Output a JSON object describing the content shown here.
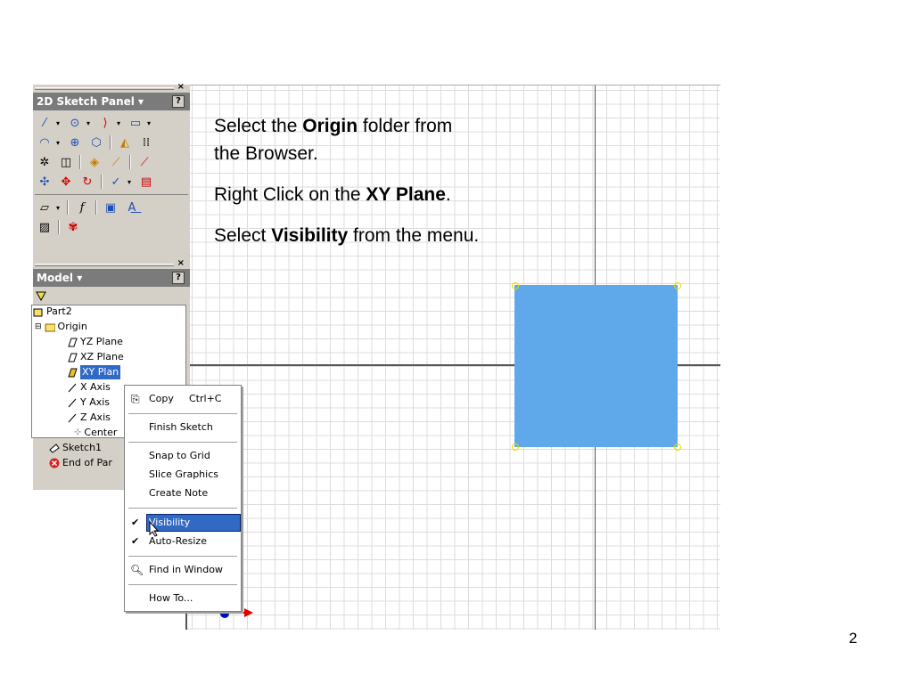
{
  "sketch_panel": {
    "title": "2D Sketch Panel ▾",
    "help": "?",
    "close": "×"
  },
  "model_panel": {
    "title": "Model ▾",
    "help": "?",
    "close": "×",
    "tree": {
      "part": "Part2",
      "origin": "Origin",
      "yz": "YZ Plane",
      "xz": "XZ Plane",
      "xy": "XY Plan",
      "x_axis": "X Axis",
      "y_axis": "Y Axis",
      "z_axis": "Z Axis",
      "center": "Center",
      "sketch": "Sketch1",
      "end": "End of Par"
    }
  },
  "context_menu": {
    "copy": "Copy",
    "copy_shortcut": "Ctrl+C",
    "finish_sketch": "Finish Sketch",
    "snap_to_grid": "Snap to Grid",
    "slice_graphics": "Slice Graphics",
    "create_note": "Create Note",
    "visibility": "Visibility",
    "auto_resize": "Auto-Resize",
    "find_in_window": "Find in Window",
    "how_to": "How To..."
  },
  "instructions": {
    "line1_pre": "Select the ",
    "line1_bold": "Origin",
    "line1_post": " folder from",
    "line2": "the Browser.",
    "line3_pre": "Right Click on the ",
    "line3_bold": "XY Plane",
    "line3_post": ".",
    "line4_pre": "Select ",
    "line4_bold": "Visibility",
    "line4_post": " from the menu."
  },
  "page_number": "2",
  "colors": {
    "rectangle_fill": "#5fa8ea",
    "selection": "#316ac5",
    "panel_bg": "#d4d0c8"
  }
}
